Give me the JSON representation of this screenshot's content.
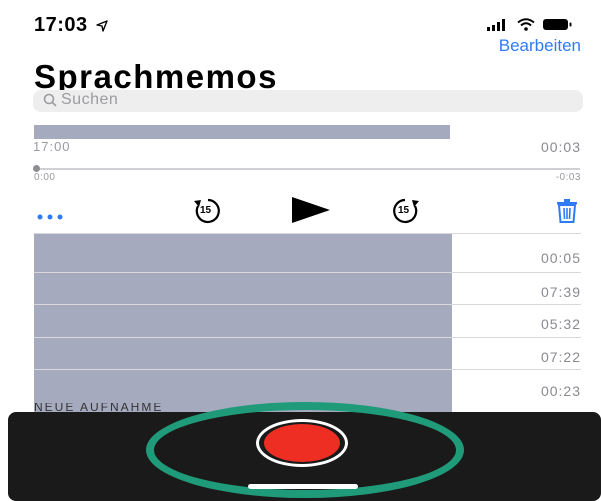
{
  "status": {
    "time": "17:03"
  },
  "header": {
    "edit_label": "Bearbeiten",
    "title": "Sprachmemos"
  },
  "search": {
    "placeholder": "Suchen"
  },
  "expanded": {
    "name": "17:00",
    "duration": "00:03",
    "position": "0:00",
    "remaining": "-0:03",
    "progress_fraction": 0,
    "skip_back_label": "15",
    "skip_forward_label": "15"
  },
  "recordings": [
    {
      "duration": "00:05"
    },
    {
      "duration": "07:39"
    },
    {
      "duration": "05:32"
    },
    {
      "duration": "07:22"
    },
    {
      "duration": "00:23"
    }
  ],
  "peek_text": "NEUE AUFNAHME",
  "colors": {
    "accent": "#2f7bf5",
    "record": "#ef2e23",
    "highlight_ring": "#1f9b7a",
    "redaction": "#a6aabf",
    "record_bar": "#1a1a1a"
  }
}
